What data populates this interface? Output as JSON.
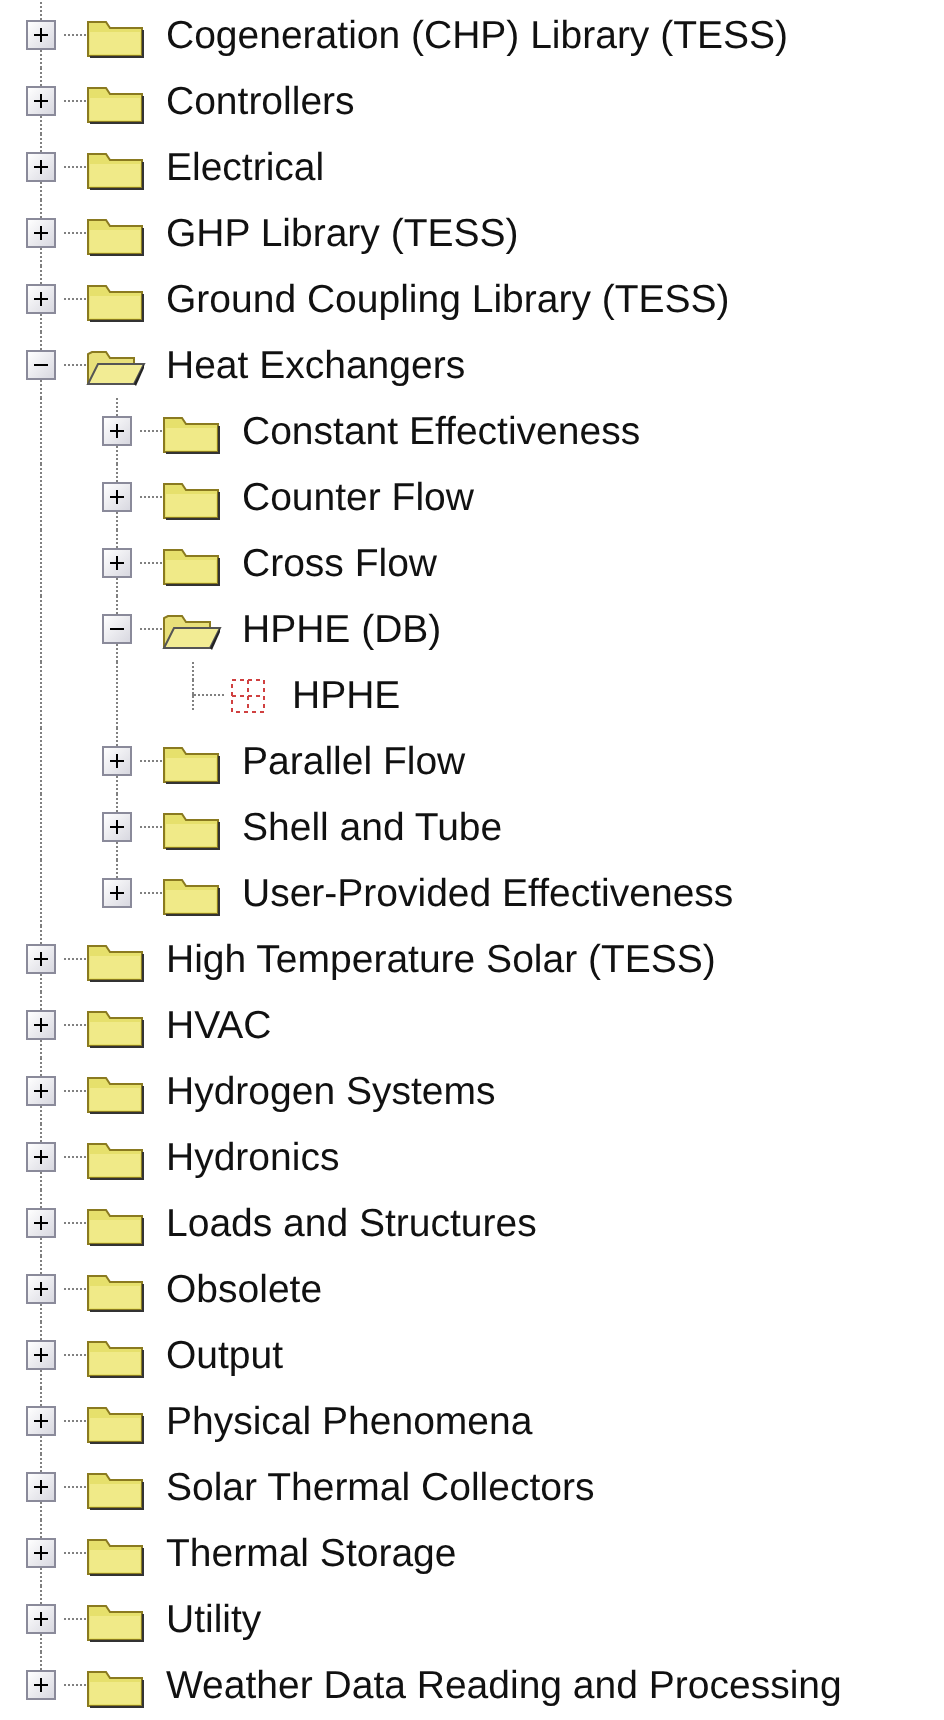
{
  "tree": [
    {
      "label": "Cogeneration (CHP) Library (TESS)",
      "kind": "folder",
      "expanded": false
    },
    {
      "label": "Controllers",
      "kind": "folder",
      "expanded": false
    },
    {
      "label": "Electrical",
      "kind": "folder",
      "expanded": false
    },
    {
      "label": "GHP Library (TESS)",
      "kind": "folder",
      "expanded": false
    },
    {
      "label": "Ground Coupling Library (TESS)",
      "kind": "folder",
      "expanded": false
    },
    {
      "label": "Heat Exchangers",
      "kind": "folder",
      "expanded": true,
      "children": [
        {
          "label": "Constant Effectiveness",
          "kind": "folder",
          "expanded": false
        },
        {
          "label": "Counter Flow",
          "kind": "folder",
          "expanded": false
        },
        {
          "label": "Cross Flow",
          "kind": "folder",
          "expanded": false
        },
        {
          "label": "HPHE (DB)",
          "kind": "folder",
          "expanded": true,
          "children": [
            {
              "label": "HPHE",
              "kind": "component"
            }
          ]
        },
        {
          "label": "Parallel Flow",
          "kind": "folder",
          "expanded": false
        },
        {
          "label": "Shell and Tube",
          "kind": "folder",
          "expanded": false
        },
        {
          "label": "User-Provided Effectiveness",
          "kind": "folder",
          "expanded": false
        }
      ]
    },
    {
      "label": "High Temperature Solar (TESS)",
      "kind": "folder",
      "expanded": false
    },
    {
      "label": "HVAC",
      "kind": "folder",
      "expanded": false
    },
    {
      "label": "Hydrogen Systems",
      "kind": "folder",
      "expanded": false
    },
    {
      "label": "Hydronics",
      "kind": "folder",
      "expanded": false
    },
    {
      "label": "Loads and Structures",
      "kind": "folder",
      "expanded": false
    },
    {
      "label": "Obsolete",
      "kind": "folder",
      "expanded": false
    },
    {
      "label": "Output",
      "kind": "folder",
      "expanded": false
    },
    {
      "label": "Physical Phenomena",
      "kind": "folder",
      "expanded": false
    },
    {
      "label": "Solar Thermal Collectors",
      "kind": "folder",
      "expanded": false
    },
    {
      "label": "Thermal Storage",
      "kind": "folder",
      "expanded": false
    },
    {
      "label": "Utility",
      "kind": "folder",
      "expanded": false
    },
    {
      "label": "Weather Data Reading and Processing",
      "kind": "folder",
      "expanded": false
    }
  ]
}
